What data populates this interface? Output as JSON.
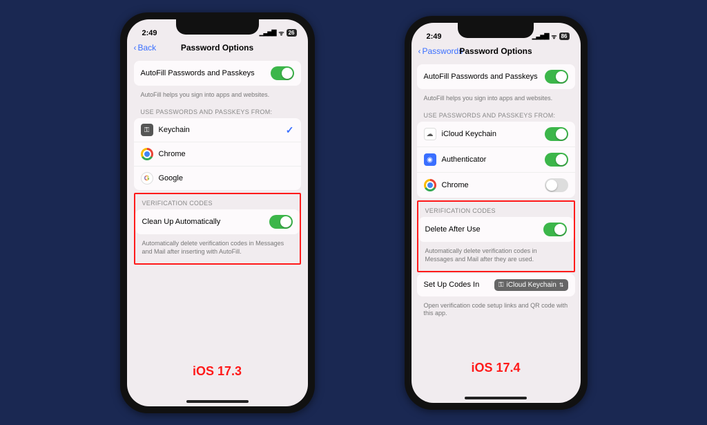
{
  "left": {
    "status": {
      "time": "2:49",
      "battery": "26"
    },
    "nav": {
      "back": "Back",
      "title": "Password Options"
    },
    "autofill": {
      "label": "AutoFill Passwords and Passkeys",
      "footer": "AutoFill helps you sign into apps and websites."
    },
    "sourcesHeader": "USE PASSWORDS AND PASSKEYS FROM:",
    "sources": [
      {
        "name": "Keychain",
        "icon": "key",
        "checked": true
      },
      {
        "name": "Chrome",
        "icon": "chrome",
        "checked": false
      },
      {
        "name": "Google",
        "icon": "google",
        "checked": false
      }
    ],
    "verification": {
      "header": "VERIFICATION CODES",
      "label": "Clean Up Automatically",
      "footer": "Automatically delete verification codes in Messages and Mail after inserting with AutoFill."
    },
    "version": "iOS 17.3"
  },
  "right": {
    "status": {
      "time": "2:49",
      "battery": "86"
    },
    "nav": {
      "back": "Passwords",
      "title": "Password Options"
    },
    "autofill": {
      "label": "AutoFill Passwords and Passkeys",
      "footer": "AutoFill helps you sign into apps and websites."
    },
    "sourcesHeader": "USE PASSWORDS AND PASSKEYS FROM:",
    "sources": [
      {
        "name": "iCloud Keychain",
        "icon": "cloud",
        "on": true
      },
      {
        "name": "Authenticator",
        "icon": "auth",
        "on": true
      },
      {
        "name": "Chrome",
        "icon": "chrome",
        "on": false
      }
    ],
    "verification": {
      "header": "VERIFICATION CODES",
      "label": "Delete After Use",
      "footer": "Automatically delete verification codes in Messages and Mail after they are used."
    },
    "setup": {
      "label": "Set Up Codes In",
      "value": "iCloud Keychain",
      "footer": "Open verification code setup links and QR code with this app."
    },
    "version": "iOS 17.4"
  }
}
